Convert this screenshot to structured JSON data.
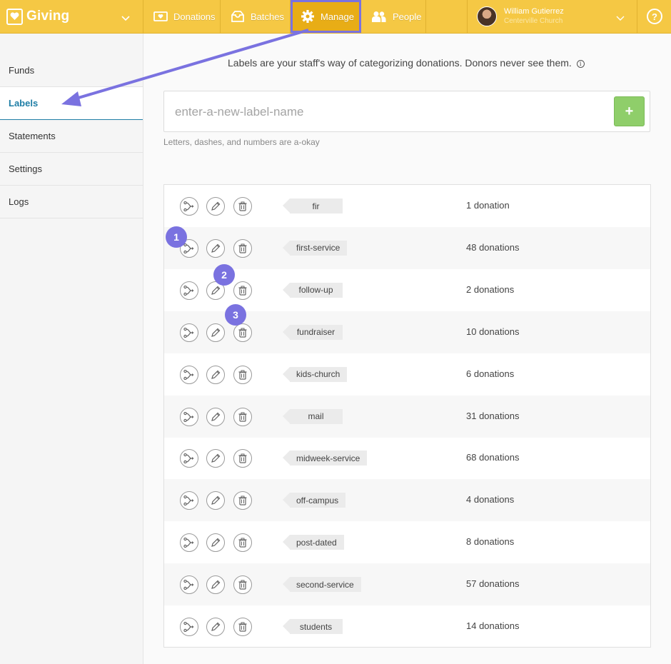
{
  "app": {
    "name": "Giving"
  },
  "nav": [
    {
      "label": "Donations",
      "icon": "donation-icon"
    },
    {
      "label": "Batches",
      "icon": "batches-icon"
    },
    {
      "label": "Manage",
      "icon": "gear-icon",
      "active": true
    },
    {
      "label": "People",
      "icon": "people-icon"
    }
  ],
  "user": {
    "name": "William Gutierrez",
    "org": "Centerville Church"
  },
  "help_label": "?",
  "sidebar": {
    "items": [
      {
        "label": "Funds"
      },
      {
        "label": "Labels",
        "active": true
      },
      {
        "label": "Statements"
      },
      {
        "label": "Settings"
      },
      {
        "label": "Logs"
      }
    ]
  },
  "main": {
    "intro": "Labels are your staff's way of categorizing donations. Donors never see them.",
    "input": {
      "placeholder": "enter-a-new-label-name",
      "value": ""
    },
    "add_label": "+",
    "hint": "Letters, dashes, and numbers are a-okay"
  },
  "labels": [
    {
      "name": "fir",
      "count": "1 donation"
    },
    {
      "name": "first-service",
      "count": "48 donations"
    },
    {
      "name": "follow-up",
      "count": "2 donations"
    },
    {
      "name": "fundraiser",
      "count": "10 donations"
    },
    {
      "name": "kids-church",
      "count": "6 donations"
    },
    {
      "name": "mail",
      "count": "31 donations"
    },
    {
      "name": "midweek-service",
      "count": "68 donations"
    },
    {
      "name": "off-campus",
      "count": "4 donations"
    },
    {
      "name": "post-dated",
      "count": "8 donations"
    },
    {
      "name": "second-service",
      "count": "57 donations"
    },
    {
      "name": "students",
      "count": "14 donations"
    }
  ],
  "annotations": {
    "step1": "1",
    "step2": "2",
    "step3": "3"
  },
  "colors": {
    "topbar": "#f5c844",
    "active_nav": "#e8ad16",
    "annotation": "#7a72e0",
    "link": "#1f7ea6",
    "add_button": "#8fce6a"
  }
}
